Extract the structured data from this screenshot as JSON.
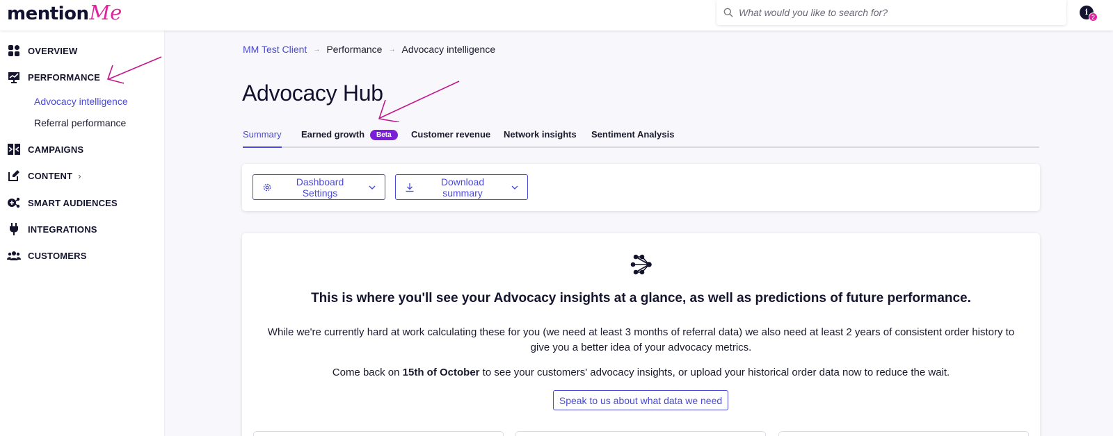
{
  "brand": {
    "logo_part1": "mention",
    "logo_part2": "Me",
    "accent": "#e0249e",
    "primary": "#4a4ad6"
  },
  "header": {
    "search_placeholder": "What would you like to search for?",
    "notification_icon_glyph": "i",
    "notification_count": "2"
  },
  "sidebar": {
    "items": [
      {
        "label": "OVERVIEW",
        "icon": "grid-icon"
      },
      {
        "label": "PERFORMANCE",
        "icon": "chart-icon"
      },
      {
        "label": "CAMPAIGNS",
        "icon": "campaigns-icon"
      },
      {
        "label": "CONTENT",
        "icon": "edit-icon",
        "chevron": "›"
      },
      {
        "label": "SMART AUDIENCES",
        "icon": "audiences-icon"
      },
      {
        "label": "INTEGRATIONS",
        "icon": "plug-icon"
      },
      {
        "label": "CUSTOMERS",
        "icon": "users-icon"
      }
    ],
    "sub_items": [
      {
        "label": "Advocacy intelligence",
        "active": true
      },
      {
        "label": "Referral performance",
        "active": false
      }
    ]
  },
  "breadcrumb": {
    "items": [
      "MM Test Client",
      "Performance",
      "Advocacy intelligence"
    ],
    "separator": "→"
  },
  "page": {
    "title": "Advocacy Hub"
  },
  "tabs": [
    {
      "label": "Summary",
      "active": true
    },
    {
      "label": "Earned growth",
      "badge": "Beta"
    },
    {
      "label": "Customer revenue"
    },
    {
      "label": "Network insights"
    },
    {
      "label": "Sentiment Analysis"
    }
  ],
  "toolbar": {
    "dashboard_settings": "Dashboard Settings",
    "download_summary": "Download summary"
  },
  "info": {
    "heading": "This is where you'll see your Advocacy insights at a glance, as well as predictions of future performance.",
    "p1": "While we're currently hard at work calculating these for you (we need at least 3 months of referral data) we also need at least 2 years of consistent order history to give you a better idea of your advocacy metrics.",
    "p2_before": "Come back on ",
    "p2_date": "15th of October",
    "p2_after": " to see your customers' advocacy insights, or upload your historical order data now to reduce the wait.",
    "cta": "Speak to us about what data we need"
  }
}
